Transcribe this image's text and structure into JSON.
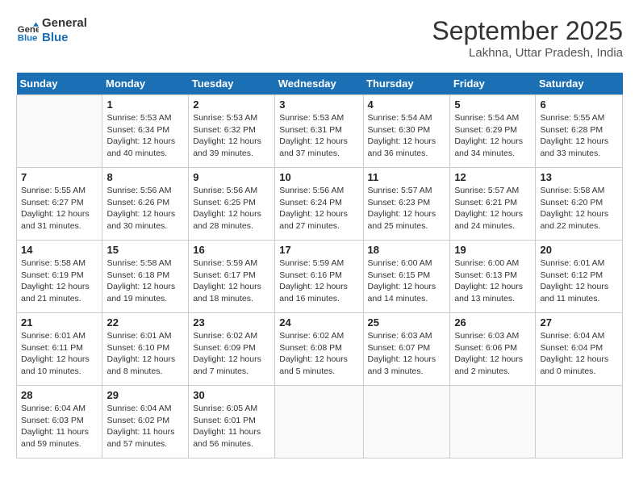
{
  "header": {
    "logo_line1": "General",
    "logo_line2": "Blue",
    "month": "September 2025",
    "location": "Lakhna, Uttar Pradesh, India"
  },
  "days_of_week": [
    "Sunday",
    "Monday",
    "Tuesday",
    "Wednesday",
    "Thursday",
    "Friday",
    "Saturday"
  ],
  "weeks": [
    [
      {
        "num": "",
        "info": ""
      },
      {
        "num": "1",
        "info": "Sunrise: 5:53 AM\nSunset: 6:34 PM\nDaylight: 12 hours\nand 40 minutes."
      },
      {
        "num": "2",
        "info": "Sunrise: 5:53 AM\nSunset: 6:32 PM\nDaylight: 12 hours\nand 39 minutes."
      },
      {
        "num": "3",
        "info": "Sunrise: 5:53 AM\nSunset: 6:31 PM\nDaylight: 12 hours\nand 37 minutes."
      },
      {
        "num": "4",
        "info": "Sunrise: 5:54 AM\nSunset: 6:30 PM\nDaylight: 12 hours\nand 36 minutes."
      },
      {
        "num": "5",
        "info": "Sunrise: 5:54 AM\nSunset: 6:29 PM\nDaylight: 12 hours\nand 34 minutes."
      },
      {
        "num": "6",
        "info": "Sunrise: 5:55 AM\nSunset: 6:28 PM\nDaylight: 12 hours\nand 33 minutes."
      }
    ],
    [
      {
        "num": "7",
        "info": "Sunrise: 5:55 AM\nSunset: 6:27 PM\nDaylight: 12 hours\nand 31 minutes."
      },
      {
        "num": "8",
        "info": "Sunrise: 5:56 AM\nSunset: 6:26 PM\nDaylight: 12 hours\nand 30 minutes."
      },
      {
        "num": "9",
        "info": "Sunrise: 5:56 AM\nSunset: 6:25 PM\nDaylight: 12 hours\nand 28 minutes."
      },
      {
        "num": "10",
        "info": "Sunrise: 5:56 AM\nSunset: 6:24 PM\nDaylight: 12 hours\nand 27 minutes."
      },
      {
        "num": "11",
        "info": "Sunrise: 5:57 AM\nSunset: 6:23 PM\nDaylight: 12 hours\nand 25 minutes."
      },
      {
        "num": "12",
        "info": "Sunrise: 5:57 AM\nSunset: 6:21 PM\nDaylight: 12 hours\nand 24 minutes."
      },
      {
        "num": "13",
        "info": "Sunrise: 5:58 AM\nSunset: 6:20 PM\nDaylight: 12 hours\nand 22 minutes."
      }
    ],
    [
      {
        "num": "14",
        "info": "Sunrise: 5:58 AM\nSunset: 6:19 PM\nDaylight: 12 hours\nand 21 minutes."
      },
      {
        "num": "15",
        "info": "Sunrise: 5:58 AM\nSunset: 6:18 PM\nDaylight: 12 hours\nand 19 minutes."
      },
      {
        "num": "16",
        "info": "Sunrise: 5:59 AM\nSunset: 6:17 PM\nDaylight: 12 hours\nand 18 minutes."
      },
      {
        "num": "17",
        "info": "Sunrise: 5:59 AM\nSunset: 6:16 PM\nDaylight: 12 hours\nand 16 minutes."
      },
      {
        "num": "18",
        "info": "Sunrise: 6:00 AM\nSunset: 6:15 PM\nDaylight: 12 hours\nand 14 minutes."
      },
      {
        "num": "19",
        "info": "Sunrise: 6:00 AM\nSunset: 6:13 PM\nDaylight: 12 hours\nand 13 minutes."
      },
      {
        "num": "20",
        "info": "Sunrise: 6:01 AM\nSunset: 6:12 PM\nDaylight: 12 hours\nand 11 minutes."
      }
    ],
    [
      {
        "num": "21",
        "info": "Sunrise: 6:01 AM\nSunset: 6:11 PM\nDaylight: 12 hours\nand 10 minutes."
      },
      {
        "num": "22",
        "info": "Sunrise: 6:01 AM\nSunset: 6:10 PM\nDaylight: 12 hours\nand 8 minutes."
      },
      {
        "num": "23",
        "info": "Sunrise: 6:02 AM\nSunset: 6:09 PM\nDaylight: 12 hours\nand 7 minutes."
      },
      {
        "num": "24",
        "info": "Sunrise: 6:02 AM\nSunset: 6:08 PM\nDaylight: 12 hours\nand 5 minutes."
      },
      {
        "num": "25",
        "info": "Sunrise: 6:03 AM\nSunset: 6:07 PM\nDaylight: 12 hours\nand 3 minutes."
      },
      {
        "num": "26",
        "info": "Sunrise: 6:03 AM\nSunset: 6:06 PM\nDaylight: 12 hours\nand 2 minutes."
      },
      {
        "num": "27",
        "info": "Sunrise: 6:04 AM\nSunset: 6:04 PM\nDaylight: 12 hours\nand 0 minutes."
      }
    ],
    [
      {
        "num": "28",
        "info": "Sunrise: 6:04 AM\nSunset: 6:03 PM\nDaylight: 11 hours\nand 59 minutes."
      },
      {
        "num": "29",
        "info": "Sunrise: 6:04 AM\nSunset: 6:02 PM\nDaylight: 11 hours\nand 57 minutes."
      },
      {
        "num": "30",
        "info": "Sunrise: 6:05 AM\nSunset: 6:01 PM\nDaylight: 11 hours\nand 56 minutes."
      },
      {
        "num": "",
        "info": ""
      },
      {
        "num": "",
        "info": ""
      },
      {
        "num": "",
        "info": ""
      },
      {
        "num": "",
        "info": ""
      }
    ]
  ]
}
